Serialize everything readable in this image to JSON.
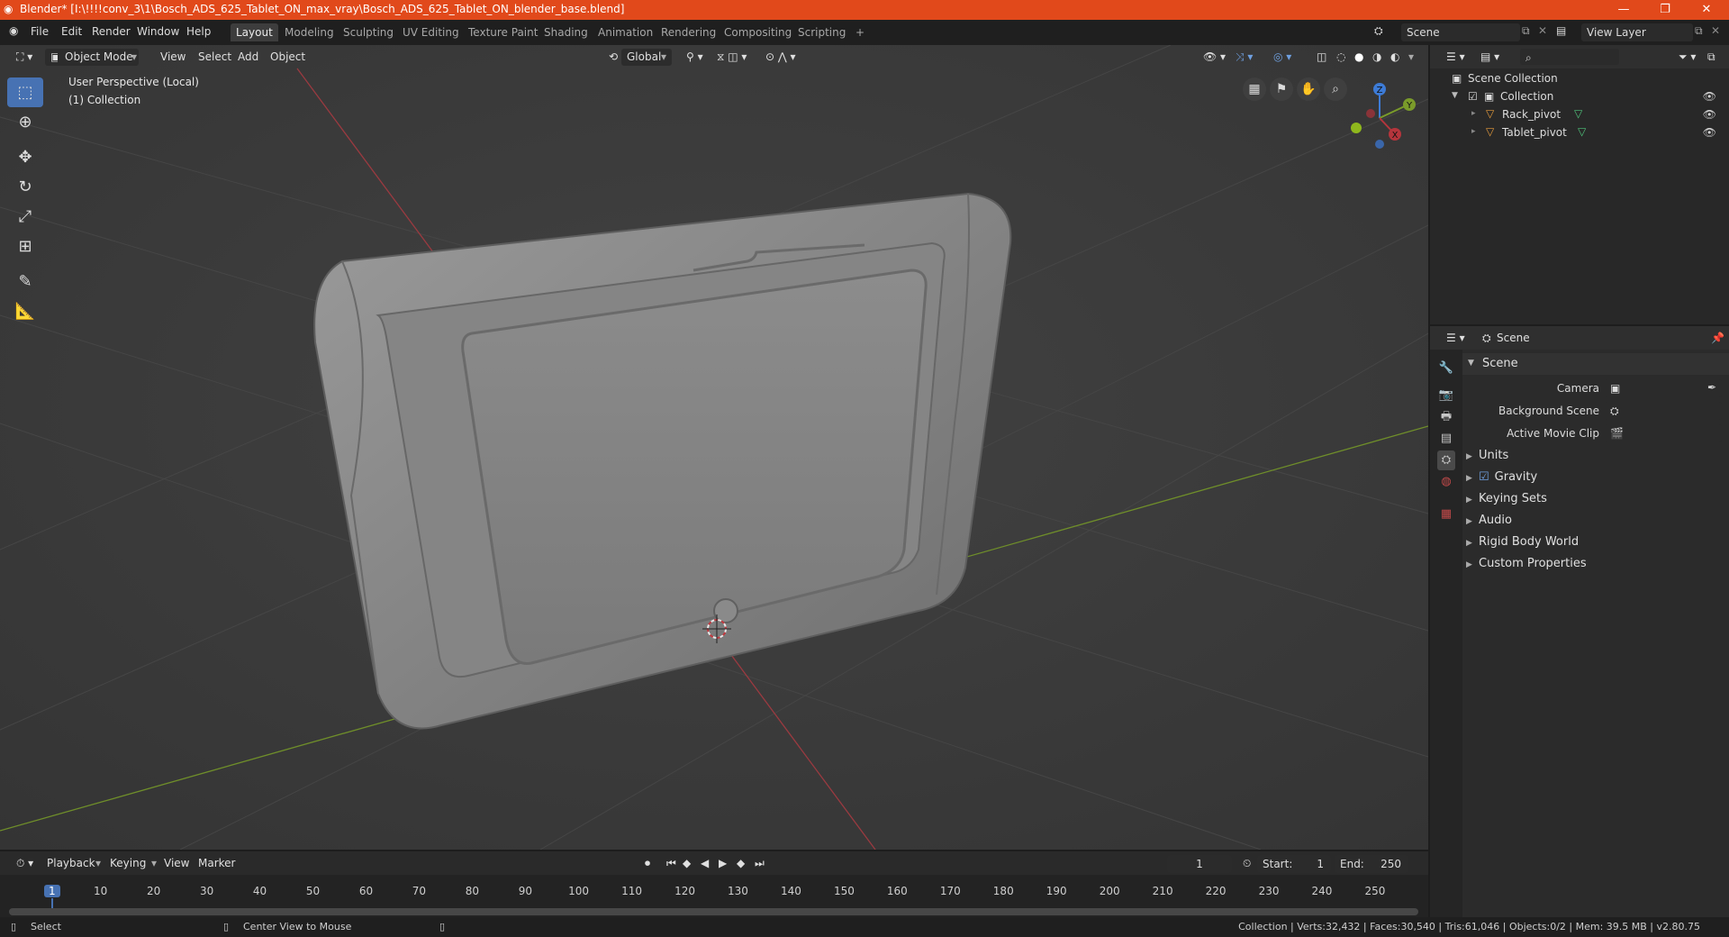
{
  "titlebar": {
    "title": "Blender* [I:\\!!!!conv_3\\1\\Bosch_ADS_625_Tablet_ON_max_vray\\Bosch_ADS_625_Tablet_ON_blender_base.blend]",
    "minimize": "—",
    "maximize": "❐",
    "close": "✕"
  },
  "menu": [
    "File",
    "Edit",
    "Render",
    "Window",
    "Help"
  ],
  "workspaces": [
    "Layout",
    "Modeling",
    "Sculpting",
    "UV Editing",
    "Texture Paint",
    "Shading",
    "Animation",
    "Rendering",
    "Compositing",
    "Scripting"
  ],
  "workspace_add": "+",
  "scene_field": "Scene",
  "view_layer_field": "View Layer",
  "viewport": {
    "mode": "Object Mode",
    "menus": [
      "View",
      "Select",
      "Add",
      "Object"
    ],
    "transform_orientation": "Global",
    "overlay_line1": "User Perspective (Local)",
    "overlay_line2": "(1) Collection",
    "gizmo": {
      "z": "Z",
      "y": "Y",
      "x": "X"
    }
  },
  "outliner": {
    "root": "Scene Collection",
    "items": [
      {
        "label": "Collection"
      },
      {
        "label": "Rack_pivot"
      },
      {
        "label": "Tablet_pivot"
      }
    ]
  },
  "properties": {
    "context": "Scene",
    "panel_title": "Scene",
    "fields": [
      {
        "label": "Camera"
      },
      {
        "label": "Background Scene"
      },
      {
        "label": "Active Movie Clip"
      }
    ],
    "panels": [
      "Units",
      "Gravity",
      "Keying Sets",
      "Audio",
      "Rigid Body World",
      "Custom Properties"
    ]
  },
  "timeline": {
    "menus": [
      "Playback",
      "Keying",
      "View",
      "Marker"
    ],
    "current_frame": "1",
    "start_label": "Start:",
    "start": "1",
    "end_label": "End:",
    "end": "250",
    "ticks": [
      "1",
      "10",
      "20",
      "30",
      "40",
      "50",
      "60",
      "70",
      "80",
      "90",
      "100",
      "110",
      "120",
      "130",
      "140",
      "150",
      "160",
      "170",
      "180",
      "190",
      "200",
      "210",
      "220",
      "230",
      "240",
      "250"
    ]
  },
  "statusbar": {
    "left1": "Select",
    "left2": "Center View to Mouse",
    "right": "Collection | Verts:32,432 | Faces:30,540 | Tris:61,046 | Objects:0/2 | Mem: 39.5 MB | v2.80.75"
  },
  "colors": {
    "accent": "#4772b3",
    "titlebar": "#e1491b",
    "x_axis": "#b5353c",
    "y_axis": "#7a9b2a",
    "z_axis": "#3d7bd6"
  }
}
